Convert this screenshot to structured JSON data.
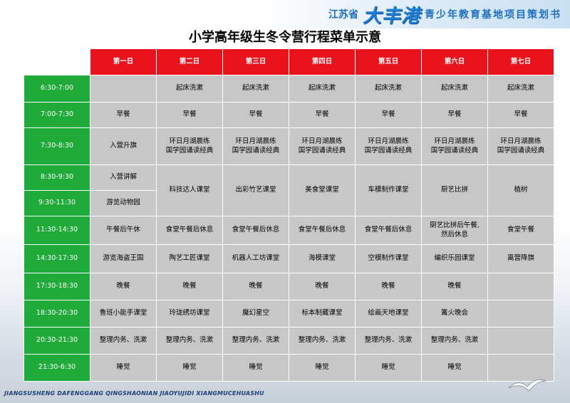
{
  "header": {
    "province": "江苏省",
    "brand": "大丰港",
    "subtitle": "青少年教育基地项目策划书"
  },
  "title": "小学高年级生冬令营行程菜单示意",
  "days": [
    "第一日",
    "第二日",
    "第三日",
    "第四日",
    "第五日",
    "第六日",
    "第七日"
  ],
  "schedule": {
    "t0": "6:30-7:00",
    "r0": [
      "",
      "起床洗漱",
      "起床洗漱",
      "起床洗漱",
      "起床洗漱",
      "起床洗漱",
      "起床洗漱"
    ],
    "t1": "7:00-7:30",
    "r1": [
      "早餐",
      "早餐",
      "早餐",
      "早餐",
      "早餐",
      "早餐",
      "早餐"
    ],
    "t2": "7:30-8:30",
    "r2": [
      "入营升旗",
      "环日月湖晨练\n国学园诵读经典",
      "环日月湖晨练\n国学园诵读经典",
      "环日月湖晨练\n国学园诵读经典",
      "环日月湖晨练\n国学园诵读经典",
      "环日月湖晨练\n国学园诵读经典",
      "环日月湖晨练\n国学园诵读经典"
    ],
    "t3": "8:30-9:30",
    "r3_first": "入营讲解",
    "t4": "9:30-11:30",
    "r4_first": "游览动物园",
    "r34_merged": [
      "科技达人课堂",
      "出彩竹艺课堂",
      "美食堂课堂",
      "车模制作课堂",
      "厨艺比拼",
      "植树"
    ],
    "t5": "11:30-14:30",
    "r5": [
      "午餐后午休",
      "食堂午餐后休息",
      "食堂午餐后休息",
      "食堂午餐后休息",
      "食堂午餐后休息",
      "厨艺比拼后午餐,\n然后休息",
      "食堂午餐"
    ],
    "t6": "14:30-17:30",
    "r6": [
      "游览海盗王国",
      "陶艺工匠课堂",
      "机器人工坊课堂",
      "海模课堂",
      "空模制作课堂",
      "编织乐园课堂",
      "离营降旗"
    ],
    "t7": "17:30-18:30",
    "r7": [
      "晚餐",
      "晚餐",
      "晚餐",
      "晚餐",
      "晚餐",
      "晚餐",
      ""
    ],
    "t8": "18:30-20:30",
    "r8": [
      "鲁班小能手课堂",
      "玲珑绣坊课堂",
      "魔幻星空",
      "标本制藏课堂",
      "绘画天地课堂",
      "篝火晚会",
      ""
    ],
    "t9": "20:30-21:30",
    "r9": [
      "整理内务、洗漱",
      "整理内务、洗漱",
      "整理内务、洗漱",
      "整理内务、洗漱",
      "整理内务、洗漱",
      "整理内务、洗漱",
      ""
    ],
    "t10": "21:30-6:30",
    "r10": [
      "睡觉",
      "睡觉",
      "睡觉",
      "睡觉",
      "睡觉",
      "睡觉",
      ""
    ]
  },
  "footer": "JIANGSUSHENG DAFENGGANG QINGSHAONIAN JIAOYUJIDI XIANGMUCEHUASHU",
  "colors": {
    "day_header": "#e8131c",
    "time_cell": "#1faa3a",
    "activity_cell": "#c7c7c7",
    "brand_blue": "#1f7fd6"
  }
}
